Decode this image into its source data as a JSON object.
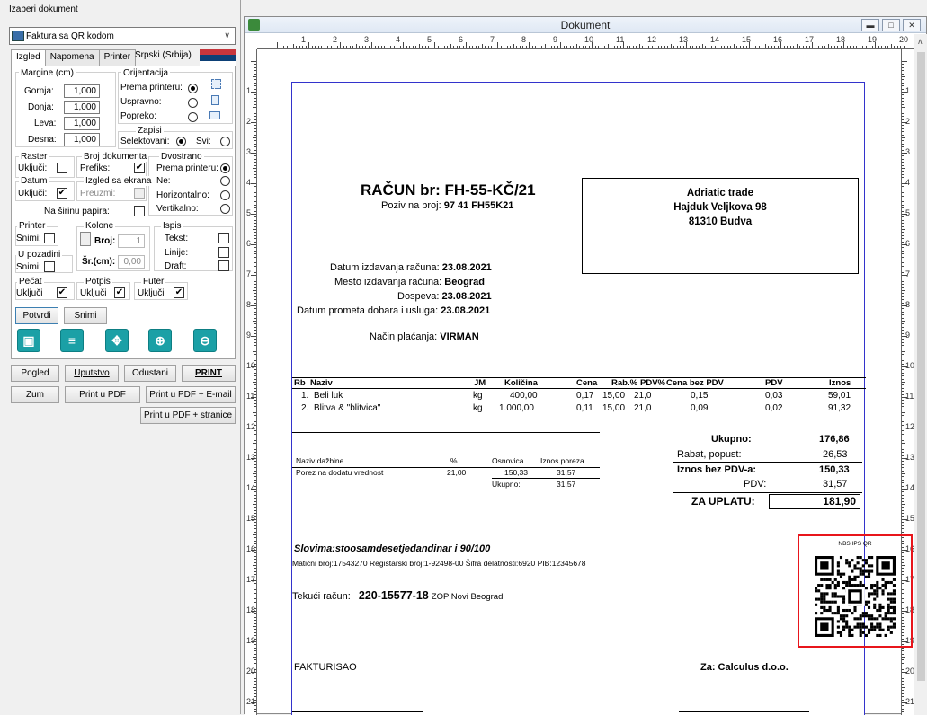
{
  "left": {
    "doc_select_label": "Izaberi dokument",
    "doc_select_value": "Faktura sa QR kodom",
    "tabs": [
      "Izgled",
      "Napomena",
      "Printer"
    ],
    "language": "Srpski (Srbija)",
    "margins": {
      "title": "Margine (cm)",
      "top_label": "Gornja:",
      "top_value": "1,000",
      "bottom_label": "Donja:",
      "bottom_value": "1,000",
      "left_label": "Leva:",
      "left_value": "1,000",
      "right_label": "Desna:",
      "right_value": "1,000"
    },
    "orientation": {
      "title": "Orijentacija",
      "printer_label": "Prema printeru:",
      "portrait_label": "Uspravno:",
      "landscape_label": "Popreko:"
    },
    "records": {
      "title": "Zapisi",
      "selected_label": "Selektovani:",
      "all_label": "Svi:"
    },
    "raster": {
      "title": "Raster",
      "on_label": "Uključi:"
    },
    "doc_number": {
      "title": "Broj dokumenta",
      "prefix_label": "Prefiks:"
    },
    "duplex": {
      "title": "Dvostrano",
      "printer_label": "Prema printeru:",
      "no_label": "Ne:",
      "horizontal_label": "Horizontalno:",
      "vertical_label": "Vertikalno:"
    },
    "date": {
      "title": "Datum",
      "on_label": "Uključi:"
    },
    "screen_layout": {
      "title": "Izgled sa ekrana",
      "take_label": "Preuzmi:"
    },
    "page_width_label": "Na širinu papira:",
    "printer": {
      "title": "Printer",
      "save_label": "Snimi:"
    },
    "columns": {
      "title": "Kolone",
      "count_label": "Broj:",
      "count_value": "1",
      "width_label": "Šr.(cm):",
      "width_value": "0,00"
    },
    "print": {
      "title": "Ispis",
      "text_label": "Tekst:",
      "lines_label": "Linije:",
      "draft_label": "Draft:"
    },
    "background": {
      "title": "U pozadini",
      "save_label": "Snimi:"
    },
    "stamp": {
      "title": "Pečat",
      "on_label": "Uključi"
    },
    "signature": {
      "title": "Potpis",
      "on_label": "Uključi"
    },
    "footer": {
      "title": "Futer",
      "on_label": "Uključi"
    },
    "confirm_btn": "Potvrdi",
    "save_btn": "Snimi",
    "buttons": {
      "preview": "Pogled",
      "guide": "Uputstvo",
      "cancel": "Odustani",
      "print": "PRINT",
      "zoom": "Zum",
      "pdf": "Print u PDF",
      "pdf_email": "Print u PDF + E-mail",
      "pdf_pages": "Print u PDF + stranice"
    }
  },
  "window": {
    "title": "Dokument",
    "ruler_numbers": [
      "1",
      "2",
      "3",
      "4",
      "5",
      "6",
      "7",
      "8",
      "9",
      "10",
      "11",
      "12",
      "13",
      "14",
      "15",
      "16",
      "17",
      "18",
      "19",
      "20"
    ],
    "vruler_numbers": [
      "1",
      "2",
      "3",
      "4",
      "5",
      "6",
      "7",
      "8",
      "9",
      "10",
      "11",
      "12",
      "13",
      "14",
      "15",
      "16",
      "17",
      "18",
      "19",
      "20",
      "21",
      "22"
    ]
  },
  "invoice": {
    "title": "RAČUN br: FH-55-KČ/21",
    "ref_label": "Poziv na broj:",
    "ref_value": "97 41  FH55K21",
    "buyer": {
      "name": "Adriatic trade",
      "street": "Hajduk Veljkova 98",
      "city": "81310 Budva"
    },
    "issue_date_label": "Datum izdavanja računa:",
    "issue_date": "23.08.2021",
    "issue_place_label": "Mesto izdavanja računa:",
    "issue_place": "Beograd",
    "due_label": "Dospeva:",
    "due": "23.08.2021",
    "delivery_label": "Datum prometa dobara i usluga:",
    "delivery": "23.08.2021",
    "payment_label": "Način plaćanja:",
    "payment": "VIRMAN",
    "columns": [
      "Rb",
      "Naziv",
      "JM",
      "Količina",
      "Cena",
      "Rab.%",
      "PDV%",
      "Cena bez PDV",
      "PDV",
      "Iznos"
    ],
    "items": [
      [
        "1.",
        "Beli luk",
        "kg",
        "400,00",
        "0,17",
        "15,00",
        "21,0",
        "0,15",
        "0,03",
        "59,01"
      ],
      [
        "2.",
        "Blitva & \"blitvica\"",
        "kg",
        "1.000,00",
        "0,11",
        "15,00",
        "21,0",
        "0,09",
        "0,02",
        "91,32"
      ]
    ],
    "tax": {
      "columns": [
        "Naziv dažbine",
        "%",
        "Osnovica",
        "Iznos poreza"
      ],
      "row": [
        "Porez na dodatu vrednost",
        "21,00",
        "150,33",
        "31,57"
      ],
      "total_label": "Ukupno:",
      "total_base": "150,33",
      "total_tax": "31,57"
    },
    "totals": {
      "total_label": "Ukupno:",
      "total": "176,86",
      "discount_label": "Rabat, popust:",
      "discount": "26,53",
      "net_label": "Iznos bez PDV-a:",
      "net": "150,33",
      "vat_label": "PDV:",
      "vat": "31,57",
      "pay_label": "ZA UPLATU:",
      "pay": "181,90"
    },
    "in_words": "Slovima:stoosamdesetjedandinar i 90/100",
    "company_line": "Matični broj:17543270 Registarski broj:1-92498-00 Šifra delatnosti:6920 PIB:12345678",
    "account_label": "Tekući račun:",
    "account_number": "220-15577-18",
    "account_bank": "ZOP Novi Beograd",
    "qr_caption": "NBS IPS QR",
    "issued_by": "FAKTURISAO",
    "for_company": "Za: Calculus d.o.o."
  }
}
